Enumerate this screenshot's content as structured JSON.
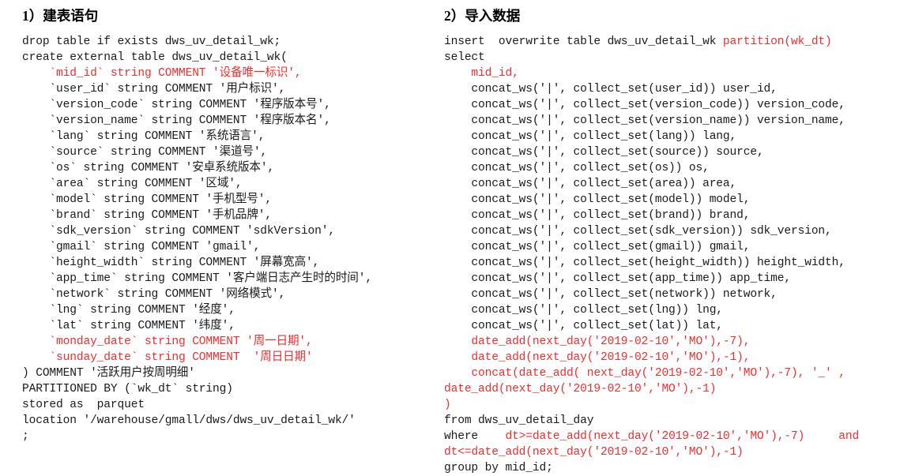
{
  "left": {
    "heading": {
      "number": "1）",
      "text": "建表语句"
    },
    "lines": [
      {
        "id": "l0",
        "segments": [
          {
            "t": "drop table if exists dws_uv_detail_wk;",
            "c": "blk"
          }
        ]
      },
      {
        "id": "l1",
        "segments": [
          {
            "t": "create external table dws_uv_detail_wk(",
            "c": "blk"
          }
        ]
      },
      {
        "id": "l2",
        "segments": [
          {
            "t": "    `mid_id` string COMMENT '设备唯一标识',",
            "c": "red"
          }
        ]
      },
      {
        "id": "l3",
        "segments": [
          {
            "t": "    `user_id` string COMMENT '用户标识',",
            "c": "blk"
          }
        ]
      },
      {
        "id": "l4",
        "segments": [
          {
            "t": "    `version_code` string COMMENT '程序版本号',",
            "c": "blk"
          }
        ]
      },
      {
        "id": "l5",
        "segments": [
          {
            "t": "    `version_name` string COMMENT '程序版本名',",
            "c": "blk"
          }
        ]
      },
      {
        "id": "l6",
        "segments": [
          {
            "t": "    `lang` string COMMENT '系统语言',",
            "c": "blk"
          }
        ]
      },
      {
        "id": "l7",
        "segments": [
          {
            "t": "    `source` string COMMENT '渠道号',",
            "c": "blk"
          }
        ]
      },
      {
        "id": "l8",
        "segments": [
          {
            "t": "    `os` string COMMENT '安卓系统版本',",
            "c": "blk"
          }
        ]
      },
      {
        "id": "l9",
        "segments": [
          {
            "t": "    `area` string COMMENT '区域',",
            "c": "blk"
          }
        ]
      },
      {
        "id": "l10",
        "segments": [
          {
            "t": "    `model` string COMMENT '手机型号',",
            "c": "blk"
          }
        ]
      },
      {
        "id": "l11",
        "segments": [
          {
            "t": "    `brand` string COMMENT '手机品牌',",
            "c": "blk"
          }
        ]
      },
      {
        "id": "l12",
        "segments": [
          {
            "t": "    `sdk_version` string COMMENT 'sdkVersion',",
            "c": "blk"
          }
        ]
      },
      {
        "id": "l13",
        "segments": [
          {
            "t": "    `gmail` string COMMENT 'gmail',",
            "c": "blk"
          }
        ]
      },
      {
        "id": "l14",
        "segments": [
          {
            "t": "    `height_width` string COMMENT '屏幕宽高',",
            "c": "blk"
          }
        ]
      },
      {
        "id": "l15",
        "segments": [
          {
            "t": "    `app_time` string COMMENT '客户端日志产生时的时间',",
            "c": "blk"
          }
        ]
      },
      {
        "id": "l16",
        "segments": [
          {
            "t": "    `network` string COMMENT '网络模式',",
            "c": "blk"
          }
        ]
      },
      {
        "id": "l17",
        "segments": [
          {
            "t": "    `lng` string COMMENT '经度',",
            "c": "blk"
          }
        ]
      },
      {
        "id": "l18",
        "segments": [
          {
            "t": "    `lat` string COMMENT '纬度',",
            "c": "blk"
          }
        ]
      },
      {
        "id": "l19",
        "segments": [
          {
            "t": "    `monday_date` string COMMENT '周一日期',",
            "c": "red"
          }
        ]
      },
      {
        "id": "l20",
        "segments": [
          {
            "t": "    `sunday_date` string COMMENT  '周日日期'",
            "c": "red"
          }
        ]
      },
      {
        "id": "l21",
        "segments": [
          {
            "t": ") COMMENT '活跃用户按周明细'",
            "c": "blk"
          }
        ]
      },
      {
        "id": "l22",
        "segments": [
          {
            "t": "PARTITIONED BY (`wk_dt` string)",
            "c": "blk"
          }
        ]
      },
      {
        "id": "l23",
        "segments": [
          {
            "t": "stored as  parquet",
            "c": "blk"
          }
        ]
      },
      {
        "id": "l24",
        "segments": [
          {
            "t": "location '/warehouse/gmall/dws/dws_uv_detail_wk/'",
            "c": "blk"
          }
        ]
      },
      {
        "id": "l25",
        "segments": [
          {
            "t": ";",
            "c": "blk"
          }
        ]
      }
    ]
  },
  "right": {
    "heading": {
      "number": "2）",
      "text": "导入数据"
    },
    "lines": [
      {
        "id": "r0",
        "segments": [
          {
            "t": "insert  overwrite table dws_uv_detail_wk ",
            "c": "blk"
          },
          {
            "t": "partition(wk_dt)",
            "c": "red"
          }
        ]
      },
      {
        "id": "r1",
        "segments": [
          {
            "t": "select",
            "c": "blk"
          }
        ]
      },
      {
        "id": "r2",
        "segments": [
          {
            "t": "    mid_id,",
            "c": "red"
          }
        ]
      },
      {
        "id": "r3",
        "segments": [
          {
            "t": "    concat_ws('|', collect_set(user_id)) user_id,",
            "c": "blk"
          }
        ]
      },
      {
        "id": "r4",
        "segments": [
          {
            "t": "    concat_ws('|', collect_set(version_code)) version_code,",
            "c": "blk"
          }
        ]
      },
      {
        "id": "r5",
        "segments": [
          {
            "t": "    concat_ws('|', collect_set(version_name)) version_name,",
            "c": "blk"
          }
        ]
      },
      {
        "id": "r6",
        "segments": [
          {
            "t": "    concat_ws('|', collect_set(lang)) lang,",
            "c": "blk"
          }
        ]
      },
      {
        "id": "r7",
        "segments": [
          {
            "t": "    concat_ws('|', collect_set(source)) source,",
            "c": "blk"
          }
        ]
      },
      {
        "id": "r8",
        "segments": [
          {
            "t": "    concat_ws('|', collect_set(os)) os,",
            "c": "blk"
          }
        ]
      },
      {
        "id": "r9",
        "segments": [
          {
            "t": "    concat_ws('|', collect_set(area)) area,",
            "c": "blk"
          }
        ]
      },
      {
        "id": "r10",
        "segments": [
          {
            "t": "    concat_ws('|', collect_set(model)) model,",
            "c": "blk"
          }
        ]
      },
      {
        "id": "r11",
        "segments": [
          {
            "t": "    concat_ws('|', collect_set(brand)) brand,",
            "c": "blk"
          }
        ]
      },
      {
        "id": "r12",
        "segments": [
          {
            "t": "    concat_ws('|', collect_set(sdk_version)) sdk_version,",
            "c": "blk"
          }
        ]
      },
      {
        "id": "r13",
        "segments": [
          {
            "t": "    concat_ws('|', collect_set(gmail)) gmail,",
            "c": "blk"
          }
        ]
      },
      {
        "id": "r14",
        "segments": [
          {
            "t": "    concat_ws('|', collect_set(height_width)) height_width,",
            "c": "blk"
          }
        ]
      },
      {
        "id": "r15",
        "segments": [
          {
            "t": "    concat_ws('|', collect_set(app_time)) app_time,",
            "c": "blk"
          }
        ]
      },
      {
        "id": "r16",
        "segments": [
          {
            "t": "    concat_ws('|', collect_set(network)) network,",
            "c": "blk"
          }
        ]
      },
      {
        "id": "r17",
        "segments": [
          {
            "t": "    concat_ws('|', collect_set(lng)) lng,",
            "c": "blk"
          }
        ]
      },
      {
        "id": "r18",
        "segments": [
          {
            "t": "    concat_ws('|', collect_set(lat)) lat,",
            "c": "blk"
          }
        ]
      },
      {
        "id": "r19",
        "segments": [
          {
            "t": "    date_add(next_day('2019-02-10','MO'),-7),",
            "c": "red"
          }
        ]
      },
      {
        "id": "r20",
        "segments": [
          {
            "t": "    date_add(next_day('2019-02-10','MO'),-1),",
            "c": "red"
          }
        ]
      },
      {
        "id": "r21",
        "segments": [
          {
            "t": "    concat(date_add( next_day('2019-02-10','MO'),-7), '_' ,",
            "c": "red"
          }
        ]
      },
      {
        "id": "r22",
        "segments": [
          {
            "t": "date_add(next_day('2019-02-10','MO'),-1)",
            "c": "red"
          }
        ]
      },
      {
        "id": "r23",
        "segments": [
          {
            "t": ")",
            "c": "red"
          }
        ]
      },
      {
        "id": "r24",
        "segments": [
          {
            "t": "from dws_uv_detail_day",
            "c": "blk"
          }
        ]
      },
      {
        "id": "r25",
        "segments": [
          {
            "t": "where   ",
            "c": "blk"
          },
          {
            "t": " dt>=date_add(next_day('2019-02-10','MO'),-7)     and",
            "c": "red"
          }
        ]
      },
      {
        "id": "r26",
        "segments": [
          {
            "t": "dt<=date_add(next_day('2019-02-10','MO'),-1)",
            "c": "red"
          }
        ]
      },
      {
        "id": "r27",
        "segments": [
          {
            "t": "group by mid_id;",
            "c": "blk"
          }
        ]
      }
    ]
  },
  "colors": {
    "accent_red": "#ef2f2f",
    "text_black": "#1a1a1a",
    "background": "#ffffff"
  }
}
